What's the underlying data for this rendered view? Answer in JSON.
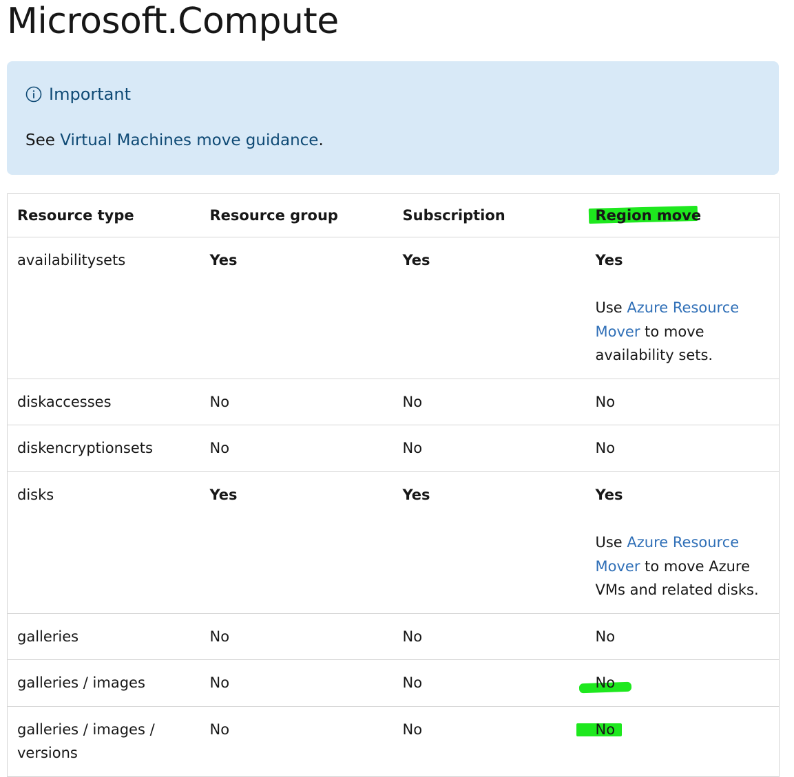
{
  "page": {
    "title": "Microsoft.Compute"
  },
  "alert": {
    "heading": "Important",
    "body_prefix": "See ",
    "link_text": "Virtual Machines move guidance",
    "body_suffix": "."
  },
  "colors": {
    "alert_background": "#d8e9f7",
    "alert_accent": "#0f4a75",
    "link": "#2f6fb7",
    "highlight": "#1ee81e"
  },
  "table": {
    "headers": [
      "Resource type",
      "Resource group",
      "Subscription",
      "Region move"
    ],
    "rows": [
      {
        "resource_type": "availabilitysets",
        "resource_group": "Yes",
        "subscription": "Yes",
        "region_move": "Yes",
        "note": {
          "prefix": "Use ",
          "link": "Azure Resource Mover",
          "suffix": " to move availability sets."
        }
      },
      {
        "resource_type": "diskaccesses",
        "resource_group": "No",
        "subscription": "No",
        "region_move": "No"
      },
      {
        "resource_type": "diskencryptionsets",
        "resource_group": "No",
        "subscription": "No",
        "region_move": "No"
      },
      {
        "resource_type": "disks",
        "resource_group": "Yes",
        "subscription": "Yes",
        "region_move": "Yes",
        "note": {
          "prefix": "Use ",
          "link": "Azure Resource Mover",
          "suffix": " to move Azure VMs and related disks."
        }
      },
      {
        "resource_type": "galleries",
        "resource_group": "No",
        "subscription": "No",
        "region_move": "No"
      },
      {
        "resource_type": "galleries / images",
        "resource_group": "No",
        "subscription": "No",
        "region_move": "No"
      },
      {
        "resource_type": "galleries / images / versions",
        "resource_group": "No",
        "subscription": "No",
        "region_move": "No"
      }
    ]
  }
}
